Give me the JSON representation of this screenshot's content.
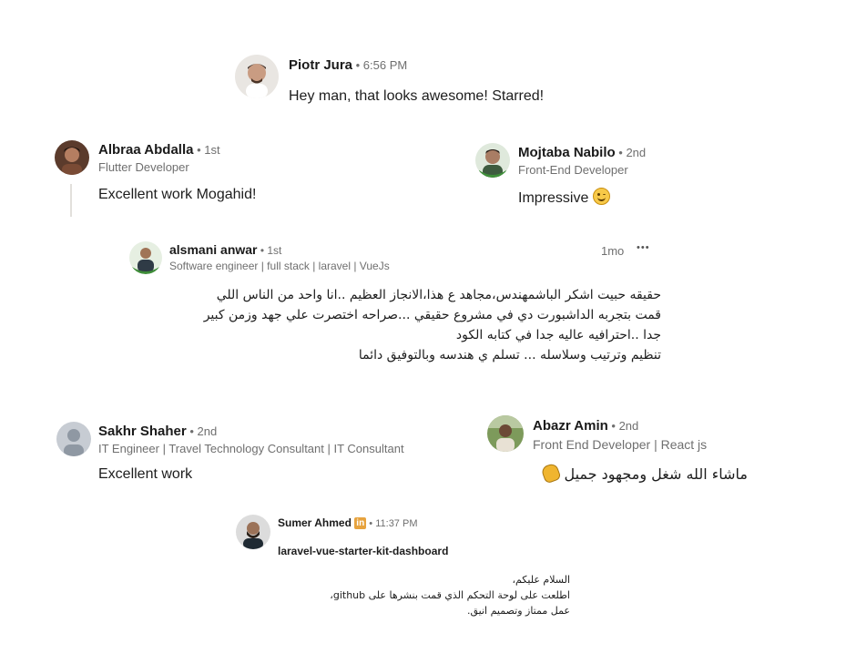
{
  "comments": [
    {
      "name": "Piotr Jura",
      "meta": " • 6:56 PM",
      "text": "Hey man, that looks awesome! Starred!"
    },
    {
      "name": "Albraa Abdalla",
      "meta": " • 1st",
      "subtitle": "Flutter Developer",
      "text": "Excellent work Mogahid!"
    },
    {
      "name": "Mojtaba Nabilo",
      "meta": " • 2nd",
      "subtitle": "Front-End Developer",
      "text": "Impressive"
    },
    {
      "name": "alsmani anwar",
      "meta": " • 1st",
      "subtitle": "Software engineer | full stack | laravel | VueJs",
      "time": "1mo",
      "more": "•••",
      "lines": [
        "حقيقه حبيت اشكر الباشمهندس،مجاهد ع هذا،الانجاز العظيم ..انا واحد من الناس اللي",
        "قمت بتجربه الداشبورت دي في مشروع حقيقي ...صراحه اختصرت علي جهد وزمن كبير",
        "جدا ..احترافيه عاليه جدا في كتابه الكود",
        "تنظيم وترتيب وسلاسله ... تسلم ي هندسه وبالتوفيق دائما"
      ]
    },
    {
      "name": "Sakhr Shaher",
      "meta": " • 2nd",
      "subtitle": "IT Engineer | Travel Technology Consultant | IT Consultant",
      "text": "Excellent work"
    },
    {
      "name": "Abazr Amin",
      "meta": " • 2nd",
      "subtitle": "Front End Developer | React js",
      "text": "ماشاء الله شغل ومجهود جميل"
    },
    {
      "name": "Sumer Ahmed",
      "badge": "in",
      "meta": " • 11:37 PM",
      "repo": "laravel-vue-starter-kit-dashboard",
      "lines": [
        "السلام عليكم،",
        "اطلعت على لوحة التحكم الذي قمت بنشرها على github،",
        "عمل ممتاز وتصميم انيق."
      ]
    }
  ],
  "icons": {
    "emoji_impressive": "smiling-face-icon",
    "emoji_clap": "clapping-hands-icon",
    "more": "more-horizontal-icon"
  }
}
